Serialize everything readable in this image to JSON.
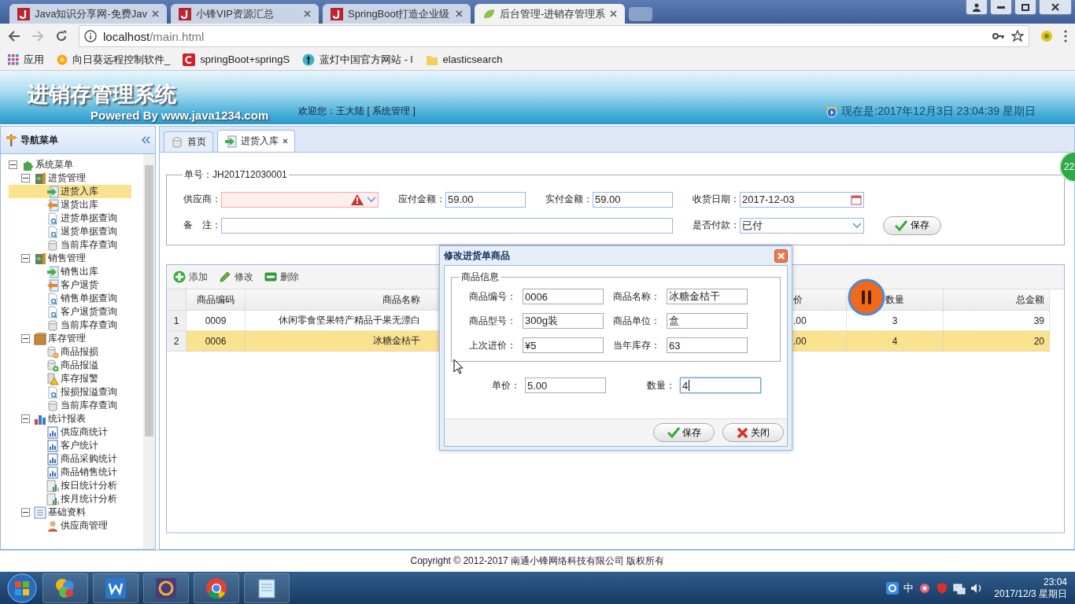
{
  "browser": {
    "tabs": [
      {
        "title": "Java知识分享网-免费Jav",
        "selected": false,
        "kind": "j"
      },
      {
        "title": "小锋VIP资源汇总",
        "selected": false,
        "kind": "j"
      },
      {
        "title": "SpringBoot打造企业级",
        "selected": false,
        "kind": "j"
      },
      {
        "title": "后台管理-进销存管理系",
        "selected": true,
        "kind": "leaf"
      }
    ],
    "address": {
      "host": "localhost",
      "path": "/main.html"
    },
    "bookmarks": [
      {
        "label": "应用",
        "kind": "apps"
      },
      {
        "label": "向日葵远程控制软件_",
        "kind": "sun"
      },
      {
        "label": "springBoot+springS",
        "kind": "red"
      },
      {
        "label": "蓝灯中国官方网站 - l",
        "kind": "lantern"
      },
      {
        "label": "elasticsearch",
        "kind": "folder"
      }
    ]
  },
  "header": {
    "title": "进销存管理系统",
    "subtitle": "Powered By www.java1234.com",
    "welcome": "欢迎您：王大陆 [ 系统管理 ]",
    "clock": "现在是:2017年12月3日 23:04:39 星期日"
  },
  "sidebar": {
    "title": "导航菜单",
    "tree": [
      {
        "label": "系统菜单",
        "kind": "puzzle",
        "selected": false,
        "expanded": true,
        "children": [
          {
            "label": "进货管理",
            "kind": "cabinet",
            "selected": false,
            "expanded": true,
            "children": [
              {
                "label": "进货入库",
                "kind": "in",
                "selected": true
              },
              {
                "label": "退货出库",
                "kind": "out",
                "selected": false
              },
              {
                "label": "进货单据查询",
                "kind": "search",
                "selected": false
              },
              {
                "label": "退货单据查询",
                "kind": "search",
                "selected": false
              },
              {
                "label": "当前库存查询",
                "kind": "db",
                "selected": false
              }
            ]
          },
          {
            "label": "销售管理",
            "kind": "cabinet",
            "selected": false,
            "expanded": true,
            "children": [
              {
                "label": "销售出库",
                "kind": "in",
                "selected": false
              },
              {
                "label": "客户退货",
                "kind": "out",
                "selected": false
              },
              {
                "label": "销售单据查询",
                "kind": "search",
                "selected": false
              },
              {
                "label": "客户退货查询",
                "kind": "search",
                "selected": false
              },
              {
                "label": "当前库存查询",
                "kind": "db",
                "selected": false
              }
            ]
          },
          {
            "label": "库存管理",
            "kind": "box",
            "selected": false,
            "expanded": true,
            "children": [
              {
                "label": "商品报损",
                "kind": "dbminus",
                "selected": false
              },
              {
                "label": "商品报溢",
                "kind": "dbplus",
                "selected": false
              },
              {
                "label": "库存报警",
                "kind": "alarm",
                "selected": false
              },
              {
                "label": "报损报溢查询",
                "kind": "search",
                "selected": false
              },
              {
                "label": "当前库存查询",
                "kind": "db",
                "selected": false
              }
            ]
          },
          {
            "label": "统计报表",
            "kind": "bars",
            "selected": false,
            "expanded": true,
            "children": [
              {
                "label": "供应商统计",
                "kind": "chartdoc",
                "selected": false
              },
              {
                "label": "客户统计",
                "kind": "chartdoc",
                "selected": false
              },
              {
                "label": "商品采购统计",
                "kind": "chartdoc",
                "selected": false
              },
              {
                "label": "商品销售统计",
                "kind": "chartdoc",
                "selected": false
              },
              {
                "label": "按日统计分析",
                "kind": "trend",
                "selected": false
              },
              {
                "label": "按月统计分析",
                "kind": "trend",
                "selected": false
              }
            ]
          },
          {
            "label": "基础资料",
            "kind": "ledger",
            "selected": false,
            "expanded": true,
            "children": [
              {
                "label": "供应商管理",
                "kind": "person",
                "selected": false
              }
            ]
          }
        ]
      }
    ]
  },
  "tabs": [
    {
      "label": "首页",
      "selected": false,
      "closable": false
    },
    {
      "label": "进货入库",
      "selected": true,
      "closable": true
    }
  ],
  "order_form": {
    "legend": "单号：JH201712030001",
    "fields": [
      {
        "label": "供应商：",
        "kind": "combo",
        "invalid": true
      },
      {
        "label": "应付金额：",
        "value": "59.00",
        "kind": "text",
        "invalid": false
      },
      {
        "label": "实付金额：",
        "value": "59.00",
        "kind": "text",
        "invalid": false
      },
      {
        "label": "收货日期：",
        "value": "2017-12-03",
        "kind": "date",
        "invalid": false
      },
      {
        "label": "备　注：",
        "kind": "wide",
        "invalid": false
      },
      {
        "label": "是否付款：",
        "value": "已付",
        "kind": "select",
        "invalid": false
      }
    ],
    "save_button": "保存"
  },
  "grid": {
    "toolbar": [
      {
        "label": "添加",
        "kind": "add"
      },
      {
        "label": "修改",
        "kind": "edit"
      },
      {
        "label": "删除",
        "kind": "delete"
      }
    ],
    "columns": [
      "商品编码",
      "商品名称",
      "价",
      "数量",
      "总金额"
    ],
    "rows": [
      {
        "number": "1",
        "selected": false,
        "cells": [
          "0009",
          "休闲零食坚果特产精品干果无漂白",
          ".00",
          "3",
          "39"
        ]
      },
      {
        "number": "2",
        "selected": true,
        "cells": [
          "0006",
          "冰糖金桔干",
          ".00",
          "4",
          "20"
        ]
      }
    ]
  },
  "dialog": {
    "title": "修改进货单商品",
    "legend": "商品信息",
    "info_fields": [
      {
        "label": "商品编号：",
        "value": "0006"
      },
      {
        "label": "商品名称：",
        "value": "冰糖金桔干"
      },
      {
        "label": "商品型号：",
        "value": "300g装"
      },
      {
        "label": "商品单位：",
        "value": "盒"
      },
      {
        "label": "上次进价：",
        "value": "¥5"
      },
      {
        "label": "当年库存：",
        "value": "63"
      }
    ],
    "edit_fields": [
      {
        "label": "单价：",
        "value": "5.00",
        "focused": false
      },
      {
        "label": "数量：",
        "value": "4",
        "focused": true
      }
    ],
    "buttons": [
      {
        "label": "保存",
        "kind": "ok"
      },
      {
        "label": "关闭",
        "kind": "cancel"
      }
    ]
  },
  "recorder_badge": "22",
  "footer": "Copyright © 2012-2017 南通小锋网络科技有限公司 版权所有",
  "taskbar": {
    "apps": [
      {
        "kind": "paint"
      },
      {
        "kind": "word"
      },
      {
        "kind": "ide"
      },
      {
        "kind": "chrome"
      },
      {
        "kind": "notepad"
      }
    ],
    "ime": "中",
    "time": "23:04",
    "date": "2017/12/3 星期日"
  }
}
